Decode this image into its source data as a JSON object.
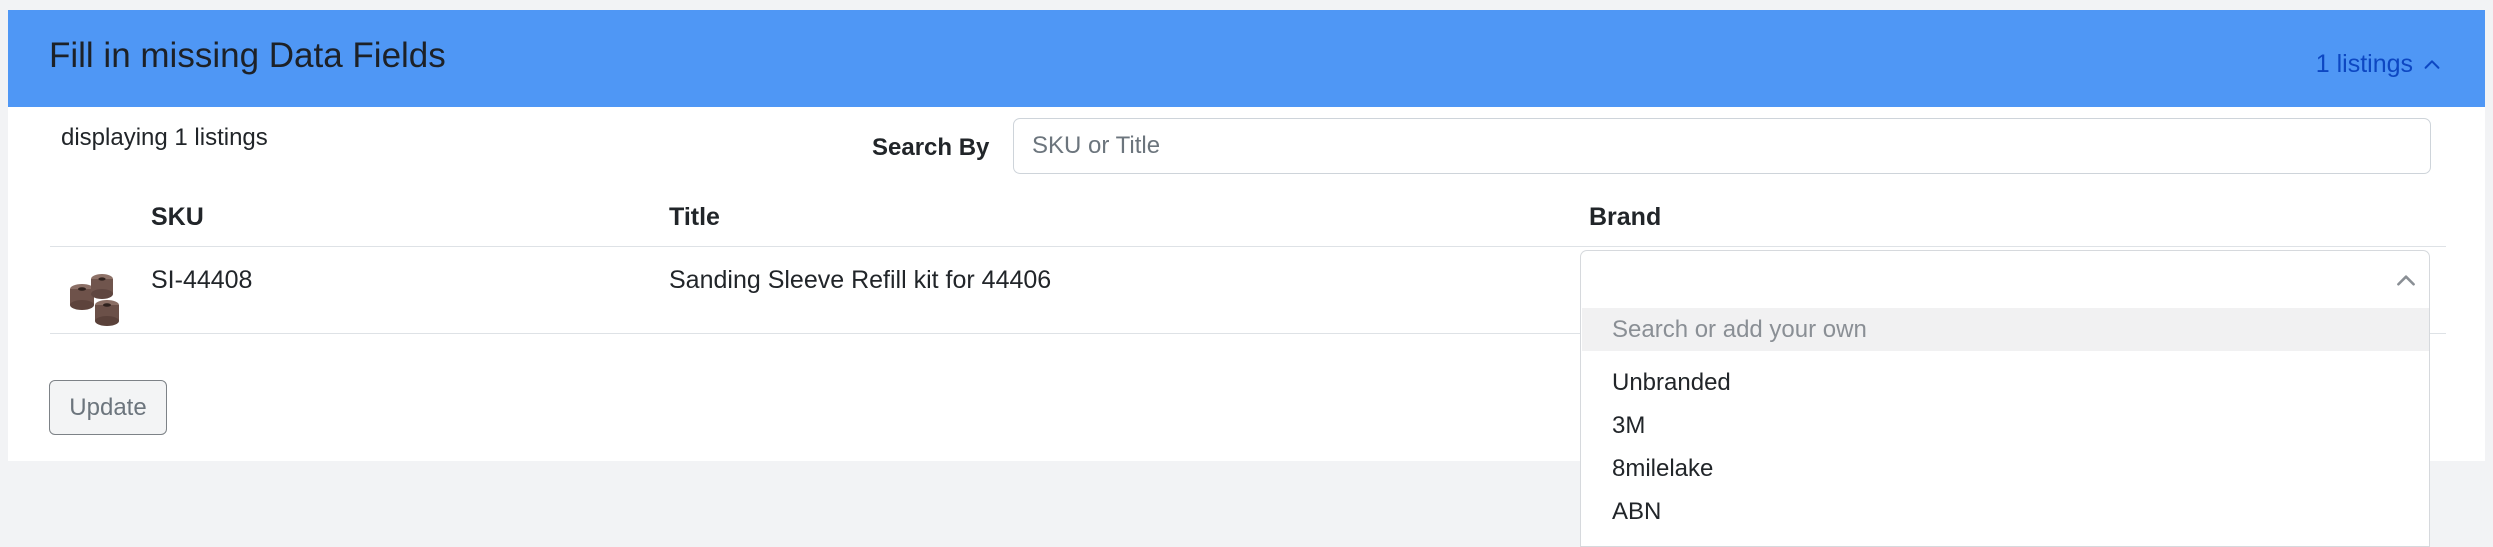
{
  "header": {
    "title": "Fill in missing Data Fields",
    "listings_toggle": "1 listings",
    "accent_color": "#4f97f5",
    "link_color": "#0d47c2"
  },
  "summary": {
    "displaying_text": "displaying 1 listings"
  },
  "search": {
    "label": "Search By",
    "placeholder": "SKU or Title",
    "value": ""
  },
  "table": {
    "columns": [
      "SKU",
      "Title",
      "Brand"
    ],
    "rows": [
      {
        "image": "sanding-sleeve-thumbnail",
        "sku": "SI-44408",
        "title": "Sanding Sleeve Refill kit for 44406",
        "brand": ""
      }
    ]
  },
  "brand_dropdown": {
    "state": "open",
    "search_placeholder": "Search or add your own",
    "options": [
      "Unbranded",
      "3M",
      "8milelake",
      "ABN"
    ]
  },
  "actions": {
    "update_label": "Update"
  }
}
